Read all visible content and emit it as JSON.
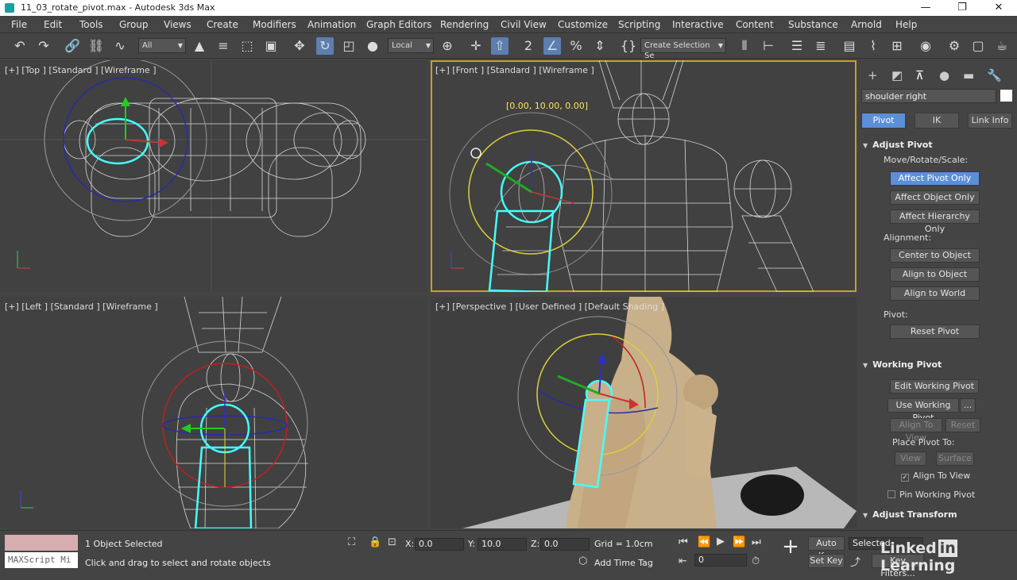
{
  "window": {
    "title": "11_03_rotate_pivot.max - Autodesk 3ds Max",
    "controls": [
      "—",
      "❐",
      "✕"
    ]
  },
  "menu": [
    "File",
    "Edit",
    "Tools",
    "Group",
    "Views",
    "Create",
    "Modifiers",
    "Animation",
    "Graph Editors",
    "Rendering",
    "Civil View",
    "Customize",
    "Scripting",
    "Interactive",
    "Content",
    "Substance",
    "Arnold",
    "Help"
  ],
  "toolbar": {
    "filter": "All",
    "refcoord": "Local",
    "selection_set": "Create Selection Se"
  },
  "viewports": {
    "top": "[+] [Top ] [Standard ] [Wireframe ]",
    "front": "[+] [Front ] [Standard ] [Wireframe ]",
    "left": "[+] [Left ] [Standard ] [Wireframe ]",
    "perspective": "[+] [Perspective ] [User Defined ] [Default Shading ]",
    "front_readout": "[0.00, 10.00, 0.00]"
  },
  "command_panel": {
    "object_name": "shoulder right",
    "tabs": [
      "Pivot",
      "IK",
      "Link Info"
    ],
    "adjust_pivot": {
      "title": "Adjust Pivot",
      "move_label": "Move/Rotate/Scale:",
      "affect_pivot": "Affect Pivot Only",
      "affect_object": "Affect Object Only",
      "affect_hierarchy": "Affect Hierarchy Only",
      "alignment_label": "Alignment:",
      "center": "Center to Object",
      "align_object": "Align to Object",
      "align_world": "Align to World",
      "pivot_label": "Pivot:",
      "reset": "Reset Pivot"
    },
    "working_pivot": {
      "title": "Working Pivot",
      "edit": "Edit Working Pivot",
      "use": "Use Working Pivot",
      "more": "...",
      "align_view": "Align To View",
      "reset": "Reset",
      "place_label": "Place Pivot To:",
      "view": "View",
      "surface": "Surface",
      "align_to_view_chk": "Align To View",
      "pin": "Pin Working Pivot"
    },
    "adjust_transform": {
      "title": "Adjust Transform"
    }
  },
  "status": {
    "maxscript": "MAXScript Mi",
    "selected": "1 Object Selected",
    "prompt": "Click and drag to select and rotate objects",
    "x_label": "X:",
    "x": "0.0",
    "y_label": "Y:",
    "y": "10.0",
    "z_label": "Z:",
    "z": "0.0",
    "grid": "Grid = 1.0cm",
    "add_time_tag": "Add Time Tag",
    "auto_key": "Auto Key",
    "set_key": "Set Key",
    "selected_combo": "Selected",
    "key_filters": "Key Filters...",
    "frame": "0"
  },
  "watermark": {
    "text": "Linked",
    "in": "in",
    "suffix": " Learning"
  }
}
